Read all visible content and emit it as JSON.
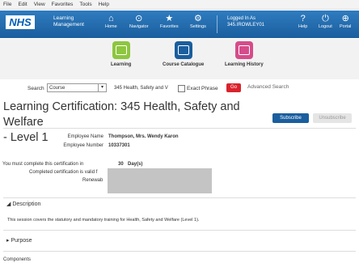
{
  "menu": [
    "File",
    "Edit",
    "View",
    "Favorites",
    "Tools",
    "Help"
  ],
  "banner": {
    "logo": "NHS",
    "app_title_line1": "Learning",
    "app_title_line2": "Management",
    "nav": [
      {
        "label": "Home",
        "icon": "home-icon"
      },
      {
        "label": "Navigator",
        "icon": "compass-icon"
      },
      {
        "label": "Favorites",
        "icon": "star-icon"
      },
      {
        "label": "Settings",
        "icon": "gear-icon"
      }
    ],
    "logged_in_label": "Logged In As",
    "logged_in_user": "345.IROWLEY01",
    "right_nav": [
      {
        "label": "Help",
        "icon": "help-icon"
      },
      {
        "label": "Logout",
        "icon": "power-icon"
      },
      {
        "label": "Portal",
        "icon": "globe-icon"
      }
    ]
  },
  "tiles": [
    {
      "label": "Learning",
      "color": "#8dc63f"
    },
    {
      "label": "Course Catalogue",
      "color": "#1a5e9e"
    },
    {
      "label": "Learning History",
      "color": "#d64b8a"
    }
  ],
  "search": {
    "label": "Search",
    "scope": "Course",
    "query": "345 Health, Safety and V",
    "exact_phrase": "Exact Phrase",
    "go": "Go",
    "advanced": "Advanced Search"
  },
  "page": {
    "title_line1": "Learning Certification: 345 Health, Safety and Welfare",
    "title_line2": "- Level 1",
    "subscribe": "Subscribe",
    "unsubscribe": "Unsubscribe"
  },
  "employee": {
    "name_label": "Employee Name",
    "name": "Thompson, Mrs. Wendy Karon",
    "number_label": "Employee Number",
    "number": "10337301"
  },
  "certification": {
    "complete_text": "You must complete this certification in",
    "days_value": "30",
    "days_unit": "Day(s)",
    "valid_text": "Completed certification is valid f",
    "renewal_text": "Renewab"
  },
  "sections": {
    "description_title": "Description",
    "description_text": "This session covers the statutory and mandatory training for Health, Safety and Welfare (Level 1).",
    "purpose_title": "Purpose",
    "components_title": "Components"
  }
}
